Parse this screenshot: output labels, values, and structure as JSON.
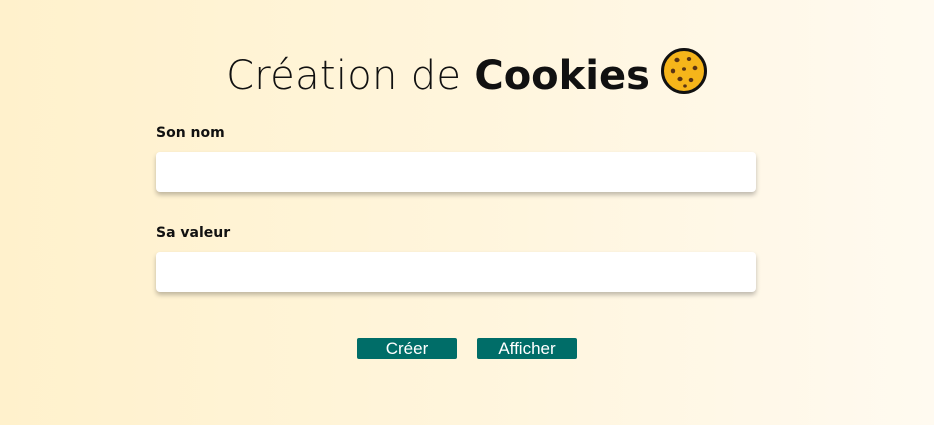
{
  "title": {
    "light": "Création de ",
    "bold": "Cookies",
    "icon": "cookie-icon"
  },
  "form": {
    "name_label": "Son nom",
    "name_value": "",
    "value_label": "Sa valeur",
    "value_value": ""
  },
  "buttons": {
    "create_label": "Créer",
    "show_label": "Afficher"
  },
  "colors": {
    "background": "#fff3d6",
    "button": "#006d68",
    "cookie": "#f6b51a"
  }
}
